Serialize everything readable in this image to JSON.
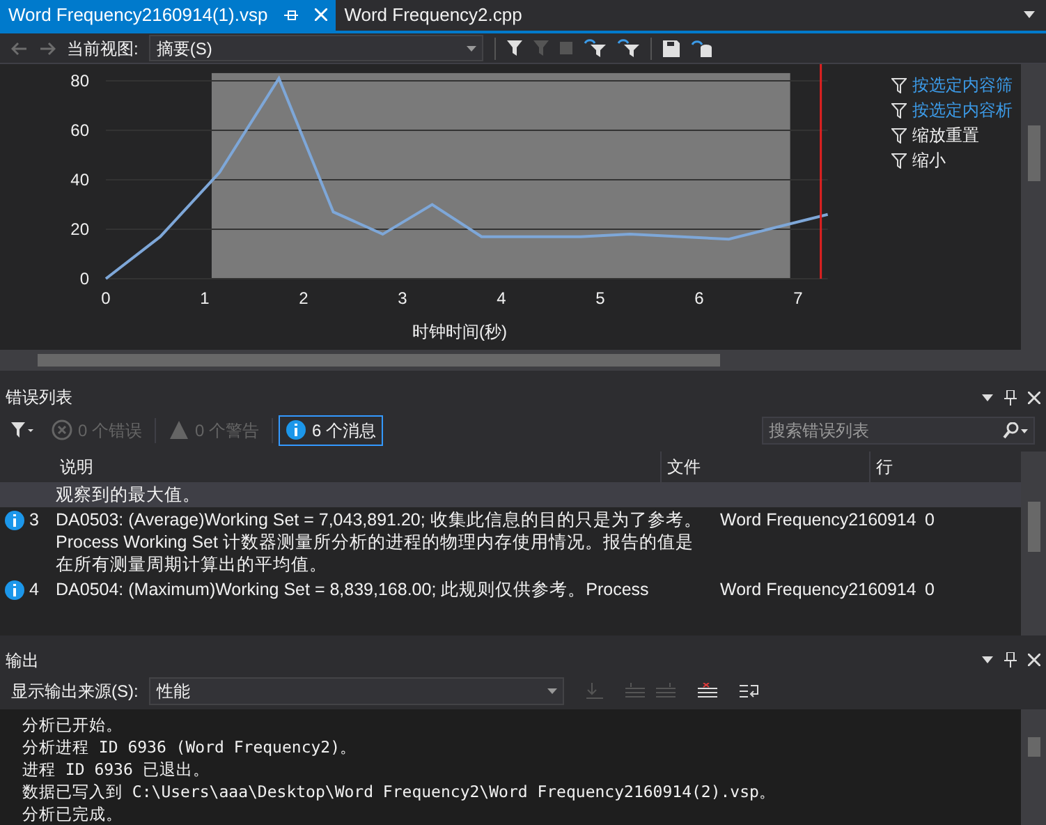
{
  "tabs": [
    {
      "label": "Word Frequency2160914(1).vsp",
      "selected": true
    },
    {
      "label": "Word Frequency2.cpp",
      "selected": false
    }
  ],
  "toolbar": {
    "view_label": "当前视图:",
    "view_value": "摘要(S)"
  },
  "chart": {
    "chart_data": {
      "type": "line",
      "xlabel": "时钟时间(秒)",
      "x": [
        0,
        0.55,
        1.15,
        1.75,
        2.3,
        2.8,
        3.3,
        3.8,
        4.8,
        5.3,
        6.3,
        7.3
      ],
      "grid": true,
      "bands": [
        {
          "axis": "x",
          "from": 1.07,
          "to": 6.92,
          "color": "#7a7a7a"
        }
      ],
      "ref_lines": [
        {
          "axis": "x",
          "value": 7.23,
          "color": "#e02020"
        }
      ],
      "series": [
        {
          "color": "#7ea7d8",
          "values": [
            0,
            17,
            43,
            81,
            27,
            18,
            30,
            17,
            17,
            18,
            16,
            26
          ]
        }
      ],
      "xlim": [
        0,
        7.3
      ],
      "ylim": [
        0,
        82
      ],
      "xticks": [
        0,
        1,
        2,
        3,
        4,
        5,
        6,
        7
      ],
      "yticks": [
        0,
        20,
        40,
        60,
        80
      ]
    }
  },
  "chart_actions": [
    {
      "label": "按选定内容筛",
      "kind": "link"
    },
    {
      "label": "按选定内容析",
      "kind": "link"
    },
    {
      "label": "缩放重置",
      "kind": "plain"
    },
    {
      "label": "缩小",
      "kind": "plain"
    }
  ],
  "error_list": {
    "title": "错误列表",
    "filters": [
      {
        "label": "0 个错误",
        "kind": "error",
        "disabled": true,
        "selected": false
      },
      {
        "label": "0 个警告",
        "kind": "warning",
        "disabled": true,
        "selected": false
      },
      {
        "label": "6 个消息",
        "kind": "info",
        "disabled": false,
        "selected": true
      }
    ],
    "search_placeholder": "搜索错误列表",
    "columns": [
      "说明",
      "文件",
      "行"
    ],
    "rows": [
      {
        "description": "观察到的最大值。",
        "selected": true
      },
      {
        "kind": "info",
        "number": "3",
        "description": "DA0503: (Average)Working Set = 7,043,891.20; 收集此信息的目的只是为了参考。Process Working Set 计数器测量所分析的进程的物理内存使用情况。报告的值是在所有测量周期计算出的平均值。",
        "file": "Word Frequency2160914",
        "line": "0",
        "selected": false
      },
      {
        "kind": "info",
        "number": "4",
        "description": "DA0504: (Maximum)Working Set = 8,839,168.00; 此规则仅供参考。Process",
        "file": "Word Frequency2160914",
        "line": "0",
        "selected": false
      }
    ]
  },
  "output": {
    "title": "输出",
    "source_label": "显示输出来源(S):",
    "source_value": "性能",
    "lines": [
      "分析已开始。",
      "分析进程 ID 6936 (Word Frequency2)。",
      "进程 ID 6936 已退出。",
      "数据已写入到 C:\\Users\\aaa\\Desktop\\Word Frequency2\\Word Frequency2160914(2).vsp。",
      "分析已完成。"
    ]
  }
}
